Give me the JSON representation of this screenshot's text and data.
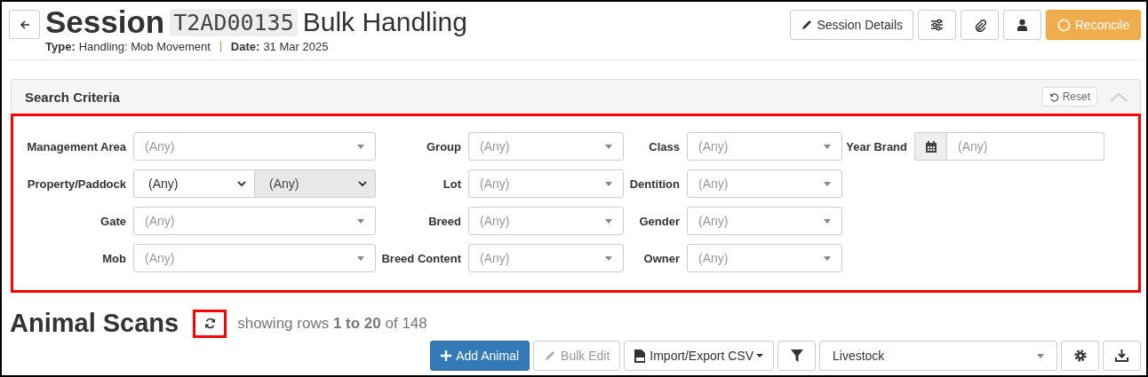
{
  "header": {
    "title": "Session",
    "code": "T2AD00135",
    "subtitle": "Bulk Handling",
    "meta": [
      {
        "label": "Type:",
        "value": "Handling: Mob Movement"
      },
      {
        "label": "Date:",
        "value": "31 Mar 2025"
      }
    ]
  },
  "toolbar": [
    {
      "kind": "details",
      "label": "Session Details"
    },
    {
      "kind": "filters"
    },
    {
      "kind": "attach"
    },
    {
      "kind": "user"
    },
    {
      "kind": "reconcile",
      "label": "Reconcile"
    }
  ],
  "search": {
    "title": "Search Criteria",
    "reset": "Reset",
    "expanded": true,
    "highlighted": true,
    "rows": [
      [
        {
          "label": "Management Area",
          "kind": "select",
          "placeholder": "(Any)"
        },
        {
          "label": "Group",
          "kind": "select",
          "placeholder": "(Any)"
        },
        {
          "label": "Class",
          "kind": "select",
          "placeholder": "(Any)"
        },
        {
          "label": "Year Brand",
          "kind": "date",
          "placeholder": "(Any)"
        }
      ],
      [
        {
          "label": "Property/Paddock",
          "kind": "split",
          "values": [
            {
              "value": "(Any)",
              "disabled": false
            },
            {
              "value": "(Any)",
              "disabled": true
            }
          ]
        },
        {
          "label": "Lot",
          "kind": "select",
          "placeholder": "(Any)"
        },
        {
          "label": "Dentition",
          "kind": "select",
          "placeholder": "(Any)"
        }
      ],
      [
        {
          "label": "Gate",
          "kind": "select",
          "placeholder": "(Any)"
        },
        {
          "label": "Breed",
          "kind": "select",
          "placeholder": "(Any)"
        },
        {
          "label": "Gender",
          "kind": "select",
          "placeholder": "(Any)"
        }
      ],
      [
        {
          "label": "Mob",
          "kind": "select",
          "placeholder": "(Any)"
        },
        {
          "label": "Breed Content",
          "kind": "select",
          "placeholder": "(Any)"
        },
        {
          "label": "Owner",
          "kind": "select",
          "placeholder": "(Any)"
        }
      ]
    ]
  },
  "scans": {
    "title": "Animal Scans",
    "refresh_highlighted": true,
    "summary": "showing rows **1 to 20** of 148",
    "actions": [
      {
        "kind": "add",
        "label": "Add Animal"
      },
      {
        "kind": "edit",
        "label": "Bulk Edit",
        "disabled": true
      },
      {
        "kind": "csv",
        "label": "Import/Export CSV"
      },
      {
        "kind": "filter"
      },
      {
        "kind": "select",
        "value": "Livestock"
      },
      {
        "kind": "settings"
      },
      {
        "kind": "download"
      }
    ]
  }
}
